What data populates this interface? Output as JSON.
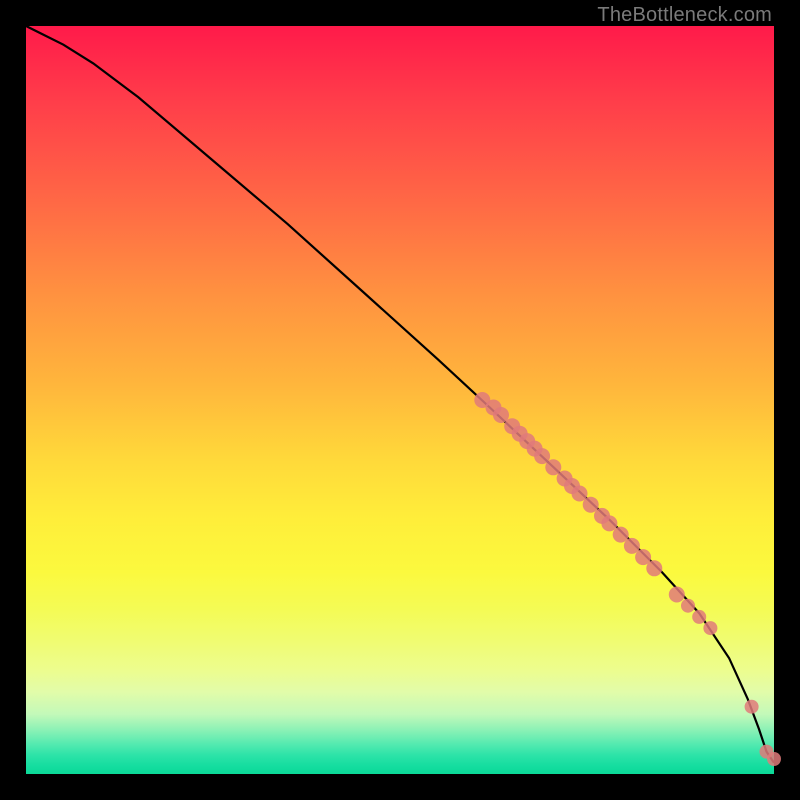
{
  "watermark": {
    "text": "TheBottleneck.com"
  },
  "chart_data": {
    "type": "line",
    "title": "",
    "xlabel": "",
    "ylabel": "",
    "xlim": [
      0,
      100
    ],
    "ylim": [
      0,
      100
    ],
    "grid": false,
    "legend": false,
    "background_gradient": "red→yellow→green (top→bottom)",
    "series": [
      {
        "name": "curve",
        "style": "line",
        "color": "#000000",
        "x": [
          0,
          2,
          5,
          9,
          15,
          25,
          35,
          45,
          55,
          62,
          70,
          78,
          85,
          90,
          94,
          96.5,
          98,
          99,
          100
        ],
        "y": [
          100,
          99,
          97.5,
          95,
          90.5,
          82,
          73.5,
          64.5,
          55.5,
          49,
          41.5,
          34,
          27,
          21.5,
          15.5,
          10,
          6,
          3,
          1.5
        ]
      },
      {
        "name": "points",
        "style": "scatter",
        "color": "#e07a7a",
        "x": [
          61,
          62.5,
          63.5,
          65,
          66,
          67,
          68,
          69,
          70.5,
          72,
          73,
          74,
          75.5,
          77,
          78,
          79.5,
          81,
          82.5,
          84,
          87,
          88.5,
          90,
          91.5,
          97,
          99,
          100
        ],
        "y": [
          50,
          49,
          48,
          46.5,
          45.5,
          44.5,
          43.5,
          42.5,
          41,
          39.5,
          38.5,
          37.5,
          36,
          34.5,
          33.5,
          32,
          30.5,
          29,
          27.5,
          24,
          22.5,
          21,
          19.5,
          9,
          3,
          2
        ]
      }
    ]
  }
}
